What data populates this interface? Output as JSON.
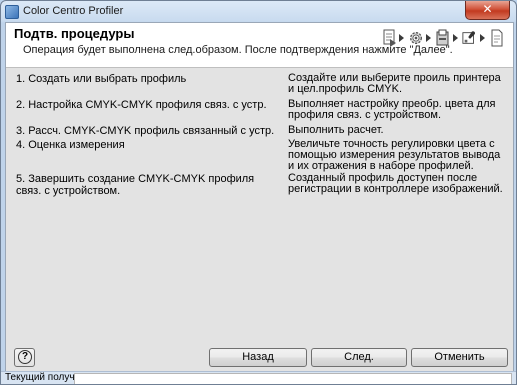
{
  "window": {
    "title": "Color Centro Profiler",
    "close_glyph": "✕"
  },
  "header": {
    "title": "Подтв. процедуры",
    "subtitle": "Операция будет выполнена след.образом. После подтверждения нажмите \"Далее\".",
    "step_icons": [
      "printer-document-icon",
      "gear-icon",
      "printer-icon",
      "eyedropper-icon",
      "document-icon"
    ]
  },
  "steps": [
    {
      "step": "1. Создать или выбрать профиль",
      "desc": "Создайте или выберите проиль принтера и цел.профиль CMYK."
    },
    {
      "step": "2. Настройка CMYK-CMYK профиля связ. с устр.",
      "desc": "Выполняет настройку преобр. цвета для профиля связ. с устройством."
    },
    {
      "step": "3. Рассч. CMYK-CMYK профиль связанный с устр.",
      "desc": "Выполнить расчет."
    },
    {
      "step": "4. Оценка измерения",
      "desc": "Увеличьте точность регулировки цвета с помощью измерения результатов вывода и их отражения в наборе профилей."
    },
    {
      "step": "5. Завершить создание CMYK-CMYK профиля связ. с устройством.",
      "desc": "Созданный профиль доступен после регистрации в контроллере изображений."
    }
  ],
  "buttons": {
    "help": "?",
    "back": "Назад",
    "next": "След.",
    "cancel": "Отменить"
  },
  "status": {
    "label": "Текущий получат.",
    "value": ""
  }
}
